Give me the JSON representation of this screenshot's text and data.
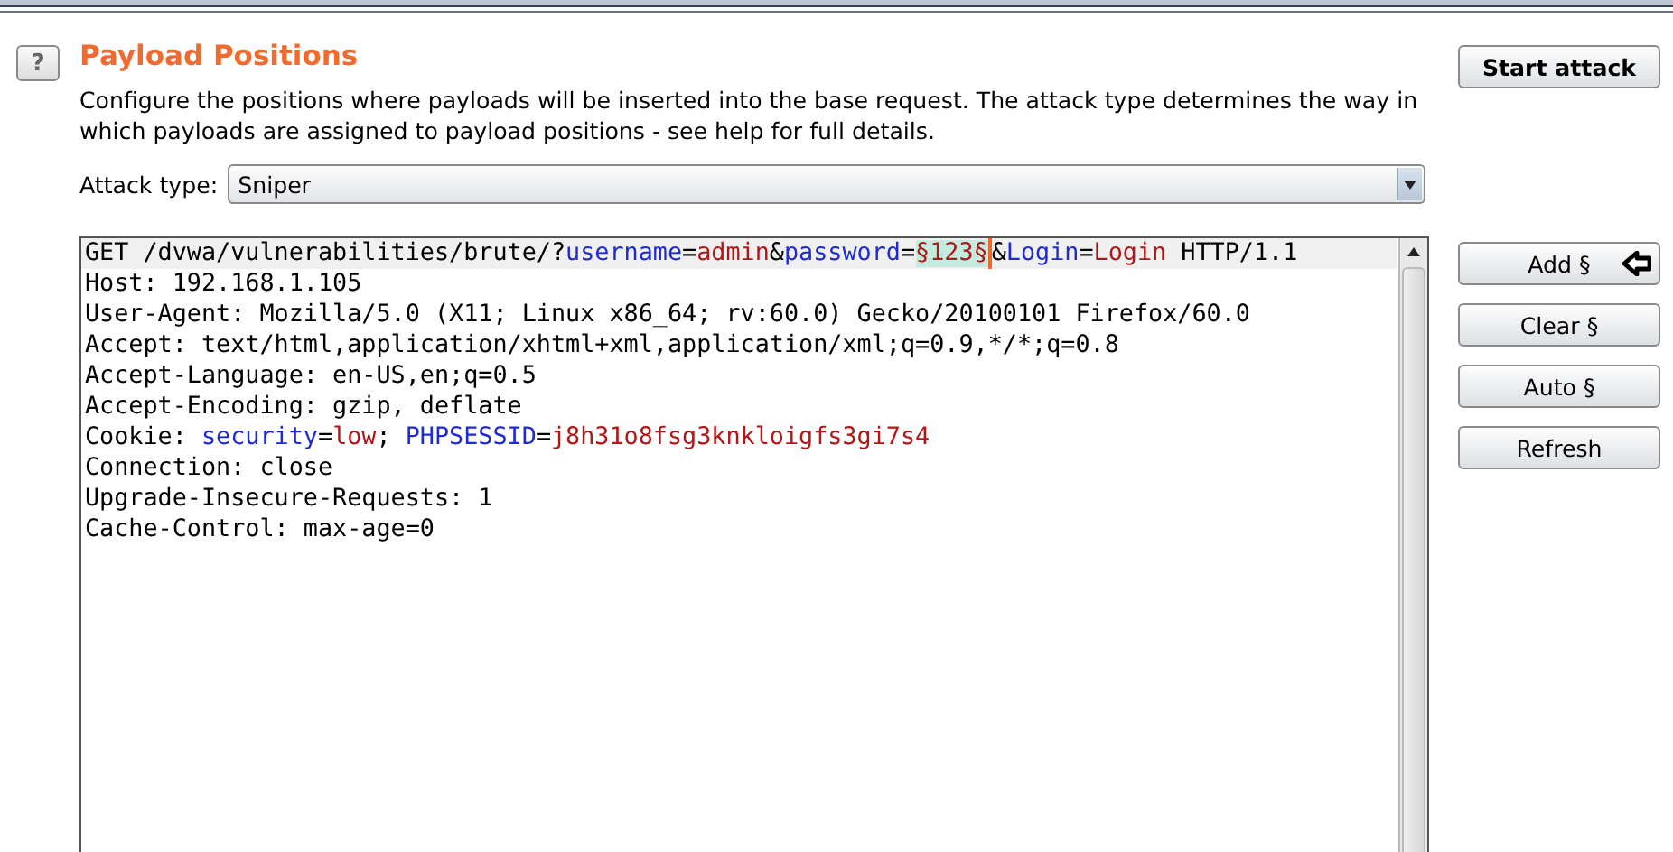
{
  "panel": {
    "help": "?",
    "title": "Payload Positions",
    "description": "Configure the positions where payloads will be inserted into the base request. The attack type determines the way in which payloads are assigned to payload positions - see help for full details.",
    "start_button": "Start attack"
  },
  "attack_type": {
    "label": "Attack type:",
    "value": "Sniper"
  },
  "request": {
    "lines": [
      {
        "selected": true,
        "segments": [
          {
            "kind": "text",
            "text": "GET /dvwa/vulnerabilities/brute/?"
          },
          {
            "kind": "name",
            "text": "username"
          },
          {
            "kind": "text",
            "text": "="
          },
          {
            "kind": "value",
            "text": "admin"
          },
          {
            "kind": "text",
            "text": "&"
          },
          {
            "kind": "name",
            "text": "password"
          },
          {
            "kind": "text",
            "text": "="
          },
          {
            "kind": "payload",
            "text": "§123§"
          },
          {
            "kind": "caret"
          },
          {
            "kind": "text",
            "text": "&"
          },
          {
            "kind": "name",
            "text": "Login"
          },
          {
            "kind": "text",
            "text": "="
          },
          {
            "kind": "value",
            "text": "Login"
          },
          {
            "kind": "text",
            "text": " HTTP/1.1"
          }
        ]
      },
      {
        "selected": false,
        "segments": [
          {
            "kind": "text",
            "text": "Host: 192.168.1.105"
          }
        ]
      },
      {
        "selected": false,
        "segments": [
          {
            "kind": "text",
            "text": "User-Agent: Mozilla/5.0 (X11; Linux x86_64; rv:60.0) Gecko/20100101 Firefox/60.0"
          }
        ]
      },
      {
        "selected": false,
        "segments": [
          {
            "kind": "text",
            "text": "Accept: text/html,application/xhtml+xml,application/xml;q=0.9,*/*;q=0.8"
          }
        ]
      },
      {
        "selected": false,
        "segments": [
          {
            "kind": "text",
            "text": "Accept-Language: en-US,en;q=0.5"
          }
        ]
      },
      {
        "selected": false,
        "segments": [
          {
            "kind": "text",
            "text": "Accept-Encoding: gzip, deflate"
          }
        ]
      },
      {
        "selected": false,
        "segments": [
          {
            "kind": "text",
            "text": "Cookie: "
          },
          {
            "kind": "name",
            "text": "security"
          },
          {
            "kind": "text",
            "text": "="
          },
          {
            "kind": "value",
            "text": "low"
          },
          {
            "kind": "text",
            "text": "; "
          },
          {
            "kind": "name",
            "text": "PHPSESSID"
          },
          {
            "kind": "text",
            "text": "="
          },
          {
            "kind": "value",
            "text": "j8h31o8fsg3knkloigfs3gi7s4"
          }
        ]
      },
      {
        "selected": false,
        "segments": [
          {
            "kind": "text",
            "text": "Connection: close"
          }
        ]
      },
      {
        "selected": false,
        "segments": [
          {
            "kind": "text",
            "text": "Upgrade-Insecure-Requests: 1"
          }
        ]
      },
      {
        "selected": false,
        "segments": [
          {
            "kind": "text",
            "text": "Cache-Control: max-age=0"
          }
        ]
      }
    ]
  },
  "side_buttons": [
    {
      "label": "Add §",
      "kind": "pointed"
    },
    {
      "label": "Clear §",
      "kind": "plain"
    },
    {
      "label": "Auto §",
      "kind": "plain"
    },
    {
      "label": "Refresh",
      "kind": "plain"
    }
  ]
}
